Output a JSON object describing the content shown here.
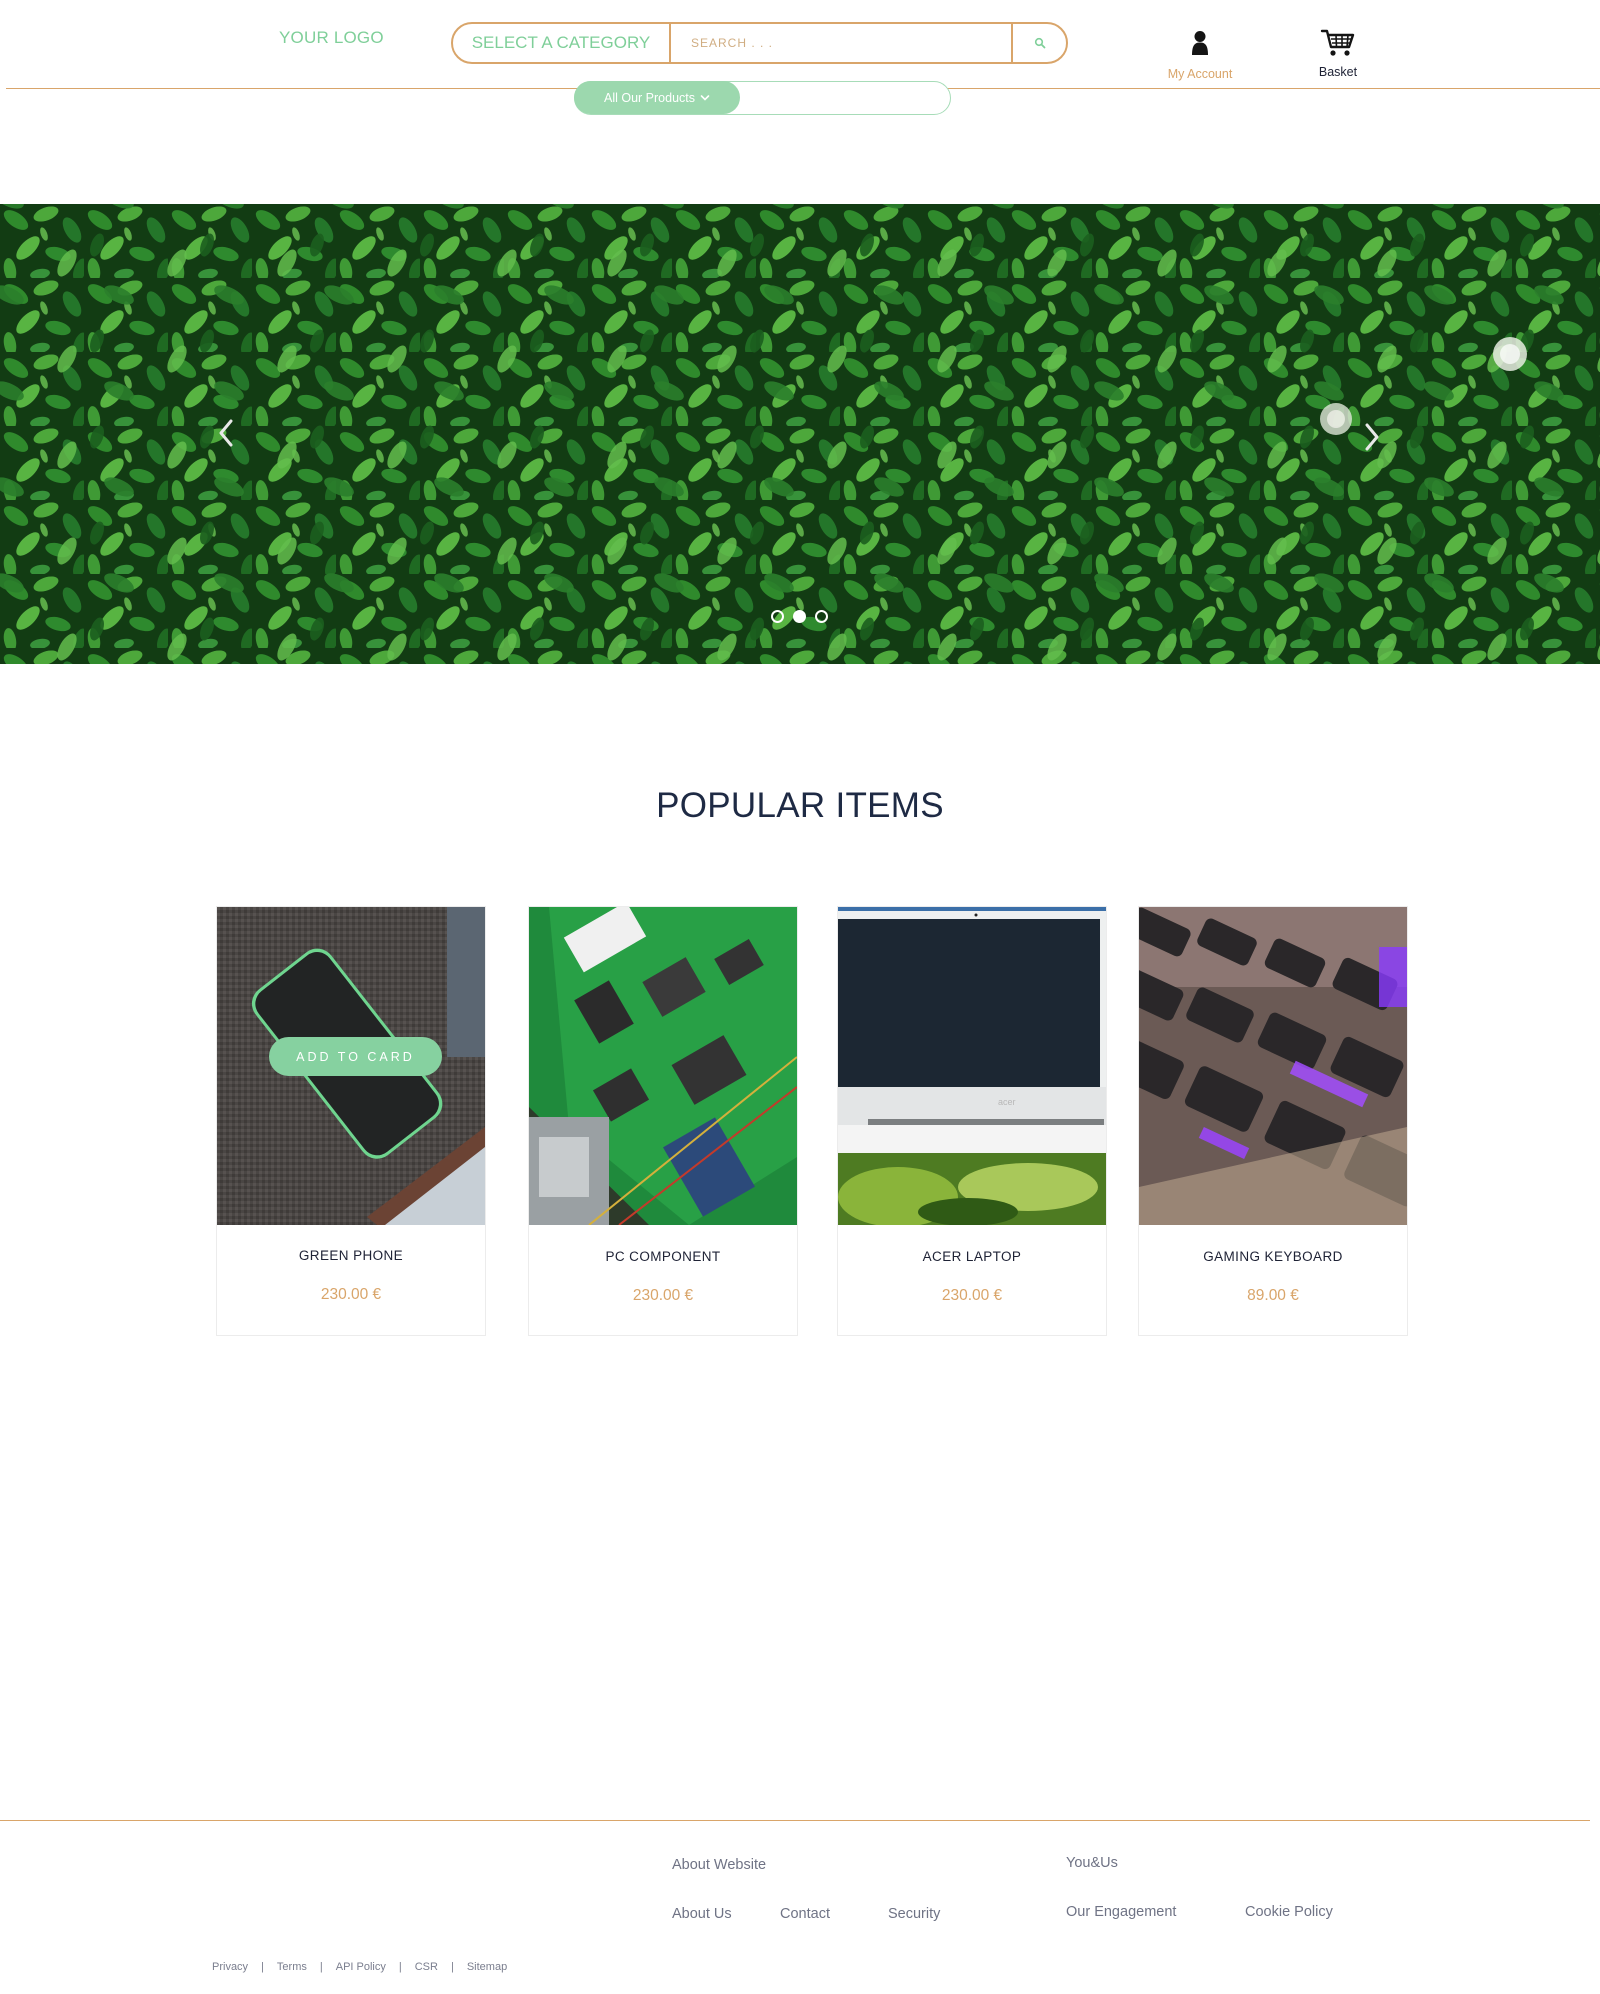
{
  "header": {
    "logo": "YOUR LOGO",
    "category_select": "SELECT A CATEGORY",
    "search_placeholder": "SEARCH . . .",
    "account_label": "My Account",
    "basket_label": "Basket",
    "products_button": "All Our Products"
  },
  "hero": {
    "slides_count": 3,
    "active_slide": 2
  },
  "popular": {
    "title": "POPULAR ITEMS",
    "add_to_cart_label": "ADD TO CARD",
    "items": [
      {
        "name": "GREEN PHONE",
        "price": "230.00 €"
      },
      {
        "name": "PC COMPONENT",
        "price": "230.00 €"
      },
      {
        "name": "ACER LAPTOP",
        "price": "230.00 €"
      },
      {
        "name": "GAMING KEYBOARD",
        "price": "89.00 €"
      }
    ]
  },
  "footer": {
    "about_website": "About Website",
    "about_us": "About Us",
    "contact": "Contact",
    "security": "Security",
    "you_and_us": "You&Us",
    "our_engagement": "Our Engagement",
    "cookie_policy": "Cookie Policy",
    "legal_links": [
      "Privacy",
      "Terms",
      "API Policy",
      "CSR",
      "Sitemap"
    ]
  },
  "colors": {
    "accent_green": "#7fcf99",
    "accent_gold": "#d9a56a",
    "heading_navy": "#1e2a44"
  }
}
